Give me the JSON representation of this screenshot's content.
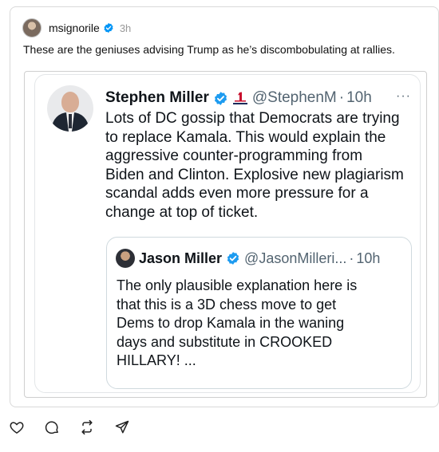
{
  "post": {
    "username": "msignorile",
    "time": "3h",
    "caption": "These are the geniuses advising Trump as he’s discombobulating at rallies."
  },
  "tweet": {
    "name": "Stephen Miller",
    "handle": "@StephenM",
    "dot": "·",
    "time": "10h",
    "more": "···",
    "flag_icon": "number-one-flag-icon",
    "lines": [
      "Lots of DC gossip that Democrats are trying",
      "to replace Kamala. This would explain the",
      "aggressive counter-programming from",
      "Biden and Clinton. Explosive new plagiarism",
      "scandal adds even more pressure for a",
      "change at top of ticket."
    ]
  },
  "quote": {
    "name": "Jason Miller",
    "handle": "@JasonMilleri...",
    "dot": "·",
    "time": "10h",
    "lines": [
      "The only plausible explanation here is",
      "that this is a 3D chess move to get",
      "Dems to drop Kamala in the waning",
      "days and substitute in CROOKED",
      "HILLARY! ..."
    ]
  },
  "actions": [
    "heart-icon",
    "comment-icon",
    "repost-icon",
    "share-icon"
  ],
  "colors": {
    "verified": "#1d9bf0",
    "threads_verified": "#0095f6",
    "secondary_text": "#536471"
  }
}
